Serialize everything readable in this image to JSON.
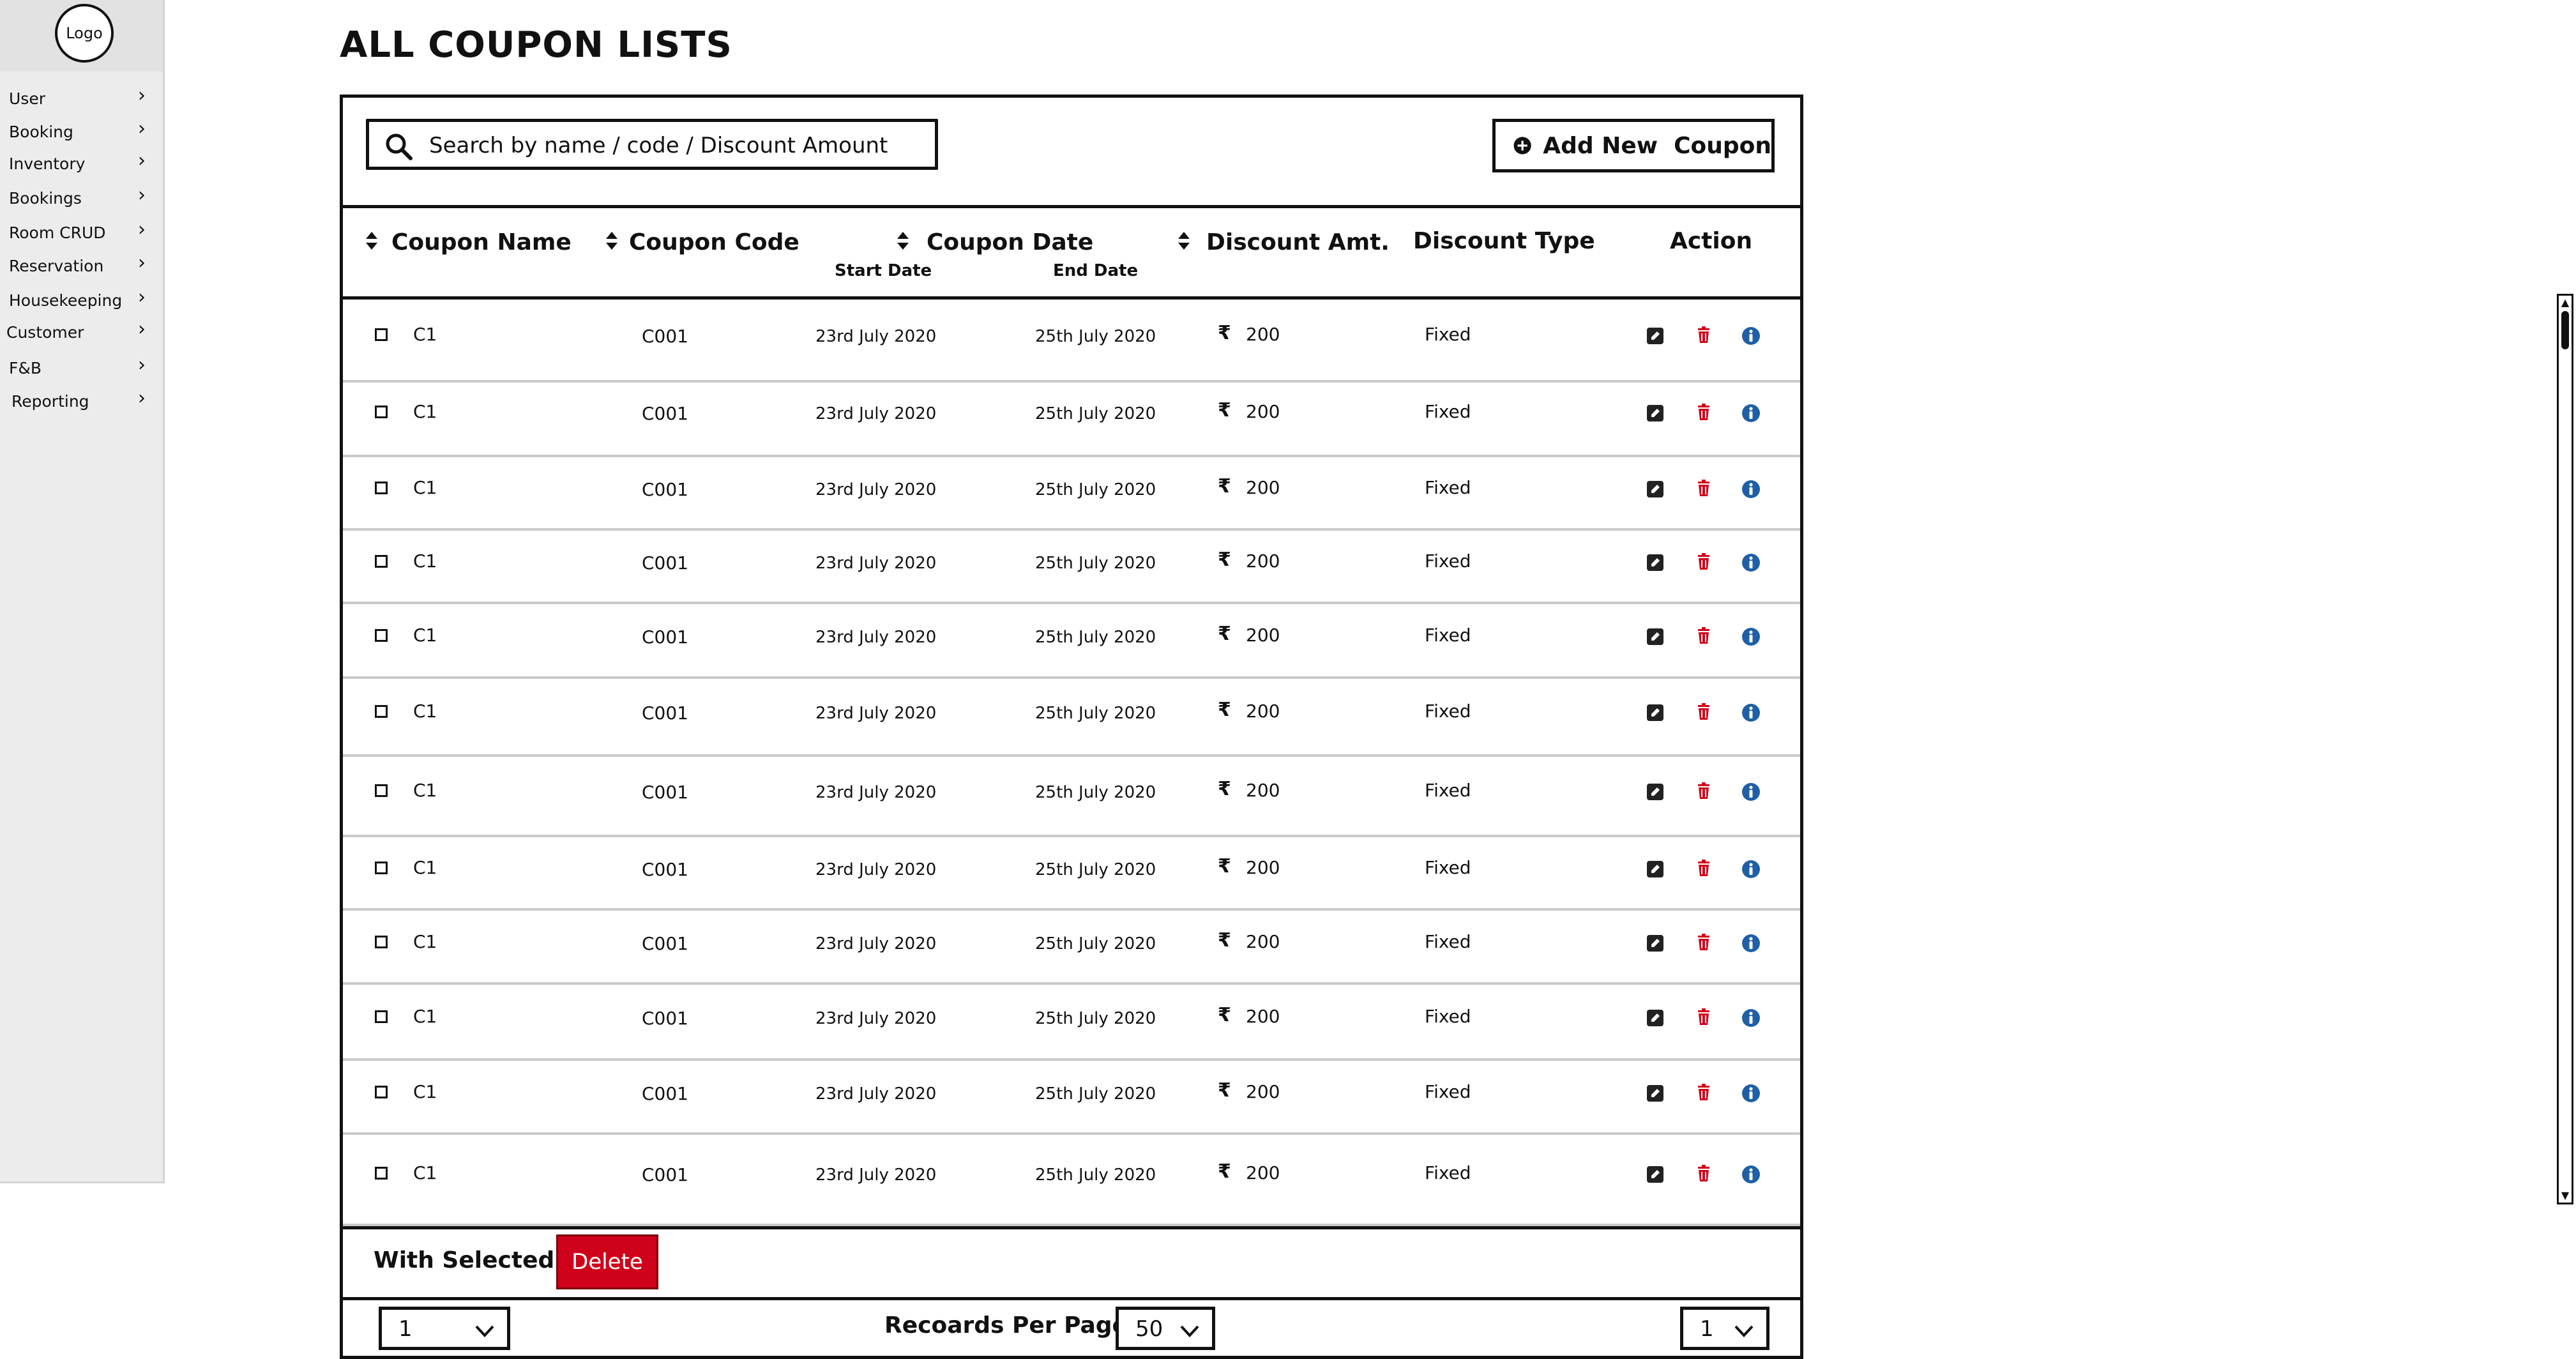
{
  "sidebar": {
    "logo": "Logo",
    "items": [
      {
        "label": "User"
      },
      {
        "label": "Booking"
      },
      {
        "label": "Inventory"
      },
      {
        "label": "Bookings"
      },
      {
        "label": "Room CRUD"
      },
      {
        "label": "Reservation"
      },
      {
        "label": "Housekeeping"
      },
      {
        "label": "Customer"
      },
      {
        "label": "F&B"
      },
      {
        "label": "Reporting"
      }
    ]
  },
  "page": {
    "title": "ALL COUPON LISTS"
  },
  "search": {
    "placeholder": "Search by name / code / Discount Amount",
    "icon": "search-icon"
  },
  "add_button": {
    "label": "Add New  Coupon",
    "icon": "plus-circle-icon"
  },
  "table": {
    "columns": {
      "name": "Coupon Name",
      "code": "Coupon Code",
      "date": "Coupon Date",
      "start": "Start Date",
      "end": "End Date",
      "amount": "Discount Amt.",
      "type": "Discount Type",
      "action": "Action"
    },
    "currency_symbol": "₹",
    "rows": [
      {
        "name": "C1",
        "code": "C001",
        "start": "23rd July 2020",
        "end": "25th July 2020",
        "amount": "200",
        "type": "Fixed"
      },
      {
        "name": "C1",
        "code": "C001",
        "start": "23rd July 2020",
        "end": "25th July 2020",
        "amount": "200",
        "type": "Fixed"
      },
      {
        "name": "C1",
        "code": "C001",
        "start": "23rd July 2020",
        "end": "25th July 2020",
        "amount": "200",
        "type": "Fixed"
      },
      {
        "name": "C1",
        "code": "C001",
        "start": "23rd July 2020",
        "end": "25th July 2020",
        "amount": "200",
        "type": "Fixed"
      },
      {
        "name": "C1",
        "code": "C001",
        "start": "23rd July 2020",
        "end": "25th July 2020",
        "amount": "200",
        "type": "Fixed"
      },
      {
        "name": "C1",
        "code": "C001",
        "start": "23rd July 2020",
        "end": "25th July 2020",
        "amount": "200",
        "type": "Fixed"
      },
      {
        "name": "C1",
        "code": "C001",
        "start": "23rd July 2020",
        "end": "25th July 2020",
        "amount": "200",
        "type": "Fixed"
      },
      {
        "name": "C1",
        "code": "C001",
        "start": "23rd July 2020",
        "end": "25th July 2020",
        "amount": "200",
        "type": "Fixed"
      },
      {
        "name": "C1",
        "code": "C001",
        "start": "23rd July 2020",
        "end": "25th July 2020",
        "amount": "200",
        "type": "Fixed"
      },
      {
        "name": "C1",
        "code": "C001",
        "start": "23rd July 2020",
        "end": "25th July 2020",
        "amount": "200",
        "type": "Fixed"
      },
      {
        "name": "C1",
        "code": "C001",
        "start": "23rd July 2020",
        "end": "25th July 2020",
        "amount": "200",
        "type": "Fixed"
      },
      {
        "name": "C1",
        "code": "C001",
        "start": "23rd July 2020",
        "end": "25th July 2020",
        "amount": "200",
        "type": "Fixed"
      }
    ]
  },
  "bulk": {
    "label": "With Selected",
    "delete_label": "Delete"
  },
  "pagination": {
    "left_select": "1",
    "records_label": "Recoards Per Page",
    "per_page": "50",
    "right_select": "1"
  },
  "colors": {
    "delete": "#d0021b",
    "trash_icon": "#d0021b",
    "info_icon": "#1f5fa8",
    "edit_icon": "#222222"
  }
}
